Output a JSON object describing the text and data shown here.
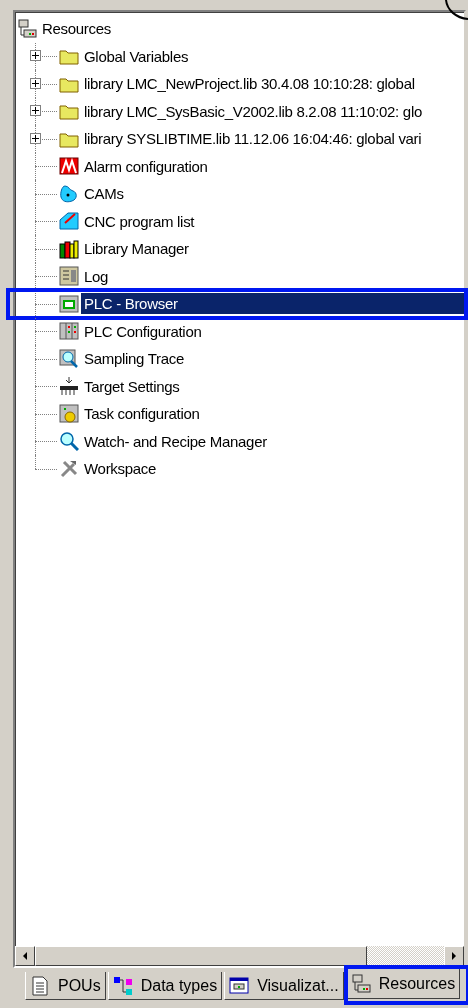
{
  "tree": {
    "label": "Resources",
    "kind": "resources",
    "children": [
      {
        "label": "Global Variables",
        "kind": "folder",
        "expandable": true,
        "selected": false,
        "highlighted": false
      },
      {
        "label": "library LMC_NewProject.lib 30.4.08 10:10:28: global",
        "kind": "folder",
        "expandable": true,
        "selected": false,
        "highlighted": false
      },
      {
        "label": "library LMC_SysBasic_V2002.lib 8.2.08 11:10:02: glo",
        "kind": "folder",
        "expandable": true,
        "selected": false,
        "highlighted": false
      },
      {
        "label": "library SYSLIBTIME.lib 11.12.06 16:04:46: global vari",
        "kind": "folder",
        "expandable": true,
        "selected": false,
        "highlighted": false
      },
      {
        "label": "Alarm configuration",
        "kind": "alarm",
        "expandable": false,
        "selected": false,
        "highlighted": false
      },
      {
        "label": "CAMs",
        "kind": "cam",
        "expandable": false,
        "selected": false,
        "highlighted": false
      },
      {
        "label": "CNC program list",
        "kind": "cnc",
        "expandable": false,
        "selected": false,
        "highlighted": false
      },
      {
        "label": "Library Manager",
        "kind": "library",
        "expandable": false,
        "selected": false,
        "highlighted": false
      },
      {
        "label": "Log",
        "kind": "log",
        "expandable": false,
        "selected": false,
        "highlighted": false
      },
      {
        "label": "PLC - Browser",
        "kind": "browser",
        "expandable": false,
        "selected": true,
        "highlighted": true
      },
      {
        "label": "PLC Configuration",
        "kind": "plcconfig",
        "expandable": false,
        "selected": false,
        "highlighted": false
      },
      {
        "label": "Sampling Trace",
        "kind": "trace",
        "expandable": false,
        "selected": false,
        "highlighted": false
      },
      {
        "label": "Target Settings",
        "kind": "target",
        "expandable": false,
        "selected": false,
        "highlighted": false
      },
      {
        "label": "Task configuration",
        "kind": "task",
        "expandable": false,
        "selected": false,
        "highlighted": false
      },
      {
        "label": "Watch- and Recipe Manager",
        "kind": "watch",
        "expandable": false,
        "selected": false,
        "highlighted": false
      },
      {
        "label": "Workspace",
        "kind": "workspace",
        "expandable": false,
        "selected": false,
        "highlighted": false
      }
    ]
  },
  "tabs": [
    {
      "label": "POUs",
      "kind": "document",
      "selected": false,
      "highlighted": false
    },
    {
      "label": "Data types",
      "kind": "datatypes",
      "selected": false,
      "highlighted": false
    },
    {
      "label": "Visualizat...",
      "kind": "visualization",
      "selected": false,
      "highlighted": false
    },
    {
      "label": "Resources",
      "kind": "resources",
      "selected": true,
      "highlighted": true
    }
  ]
}
